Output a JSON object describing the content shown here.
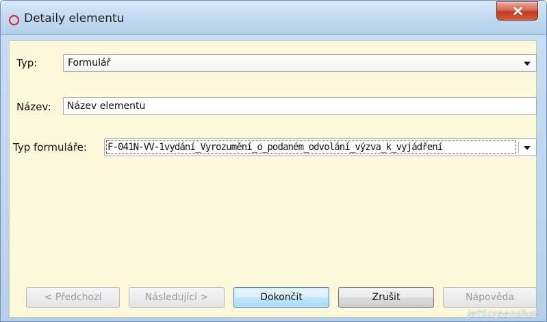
{
  "window": {
    "title": "Detaily elementu",
    "icon": "circle-outline-icon",
    "close_icon": "close-x-icon",
    "accent_color": "#d21e2e",
    "close_color": "#c33b22",
    "panel_color": "#fdf7dc"
  },
  "form": {
    "typ": {
      "label": "Typ:",
      "value": "Formulář"
    },
    "nazev": {
      "label": "Název:",
      "value": "Název elementu"
    },
    "typ_formulare": {
      "label": "Typ formuláře:",
      "value": "F-041N-VV-1vydání_Vyrozumění_o_podaném_odvolání_výzva_k_vyjádření"
    }
  },
  "buttons": {
    "previous": "< Předchozí",
    "next": "Následující >",
    "finish": "Dokončit",
    "cancel": "Zrušit",
    "help": "Nápověda"
  },
  "watermark": "jetScreenshot"
}
